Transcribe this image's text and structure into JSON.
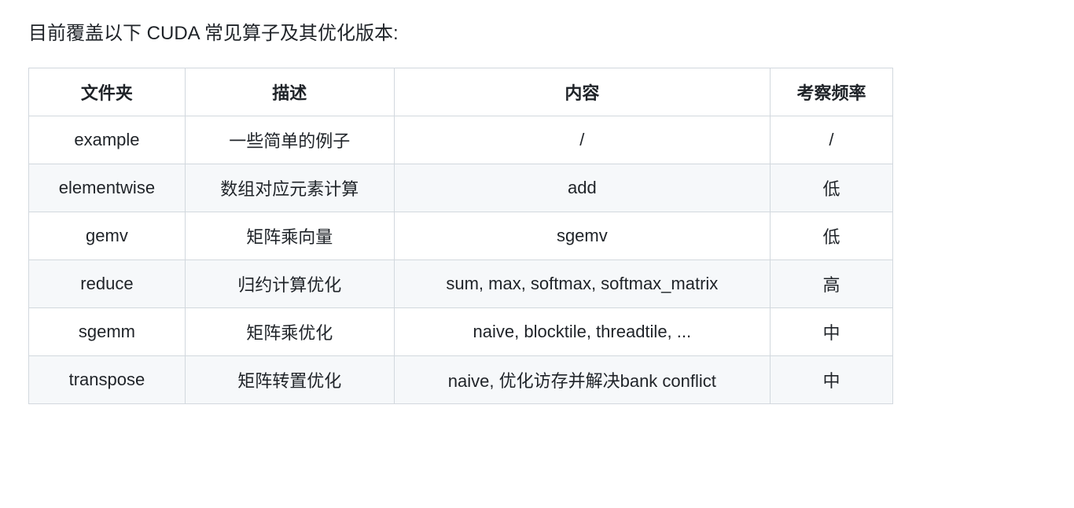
{
  "intro": "目前覆盖以下 CUDA 常见算子及其优化版本:",
  "table": {
    "headers": [
      "文件夹",
      "描述",
      "内容",
      "考察频率"
    ],
    "rows": [
      {
        "folder": "example",
        "desc": "一些简单的例子",
        "content": "/",
        "freq": "/"
      },
      {
        "folder": "elementwise",
        "desc": "数组对应元素计算",
        "content": "add",
        "freq": "低"
      },
      {
        "folder": "gemv",
        "desc": "矩阵乘向量",
        "content": "sgemv",
        "freq": "低"
      },
      {
        "folder": "reduce",
        "desc": "归约计算优化",
        "content": "sum, max, softmax, softmax_matrix",
        "freq": "高"
      },
      {
        "folder": "sgemm",
        "desc": "矩阵乘优化",
        "content": "naive, blocktile, threadtile, ...",
        "freq": "中"
      },
      {
        "folder": "transpose",
        "desc": "矩阵转置优化",
        "content": "naive, 优化访存并解决bank conflict",
        "freq": "中"
      }
    ]
  }
}
